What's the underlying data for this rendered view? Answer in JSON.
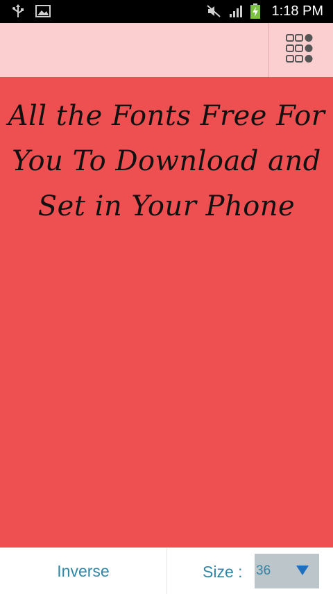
{
  "status_bar": {
    "time": "1:18 PM",
    "icons": [
      "usb-icon",
      "image-icon",
      "mute-icon",
      "signal-icon",
      "battery-charging-icon"
    ]
  },
  "action_bar": {
    "menu_icon": "grid-menu-icon"
  },
  "preview": {
    "text": "All the Fonts Free For You To Download and Set in Your Phone",
    "background_color": "#ee5052",
    "text_color": "#111111"
  },
  "bottom_bar": {
    "inverse_label": "Inverse",
    "size_label": "Size :",
    "size_value": "36",
    "accent_color": "#2f86a5"
  }
}
